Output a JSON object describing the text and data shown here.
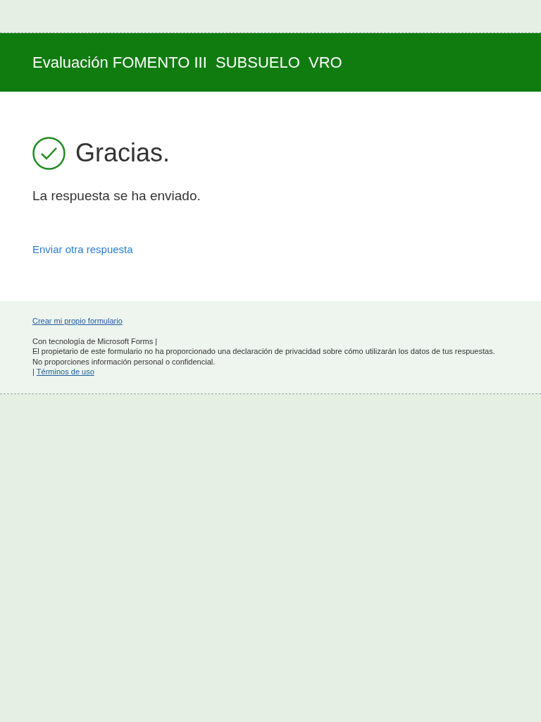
{
  "header": {
    "title": "Evaluación FOMENTO III  SUBSUELO  VRO"
  },
  "confirmation": {
    "heading": "Gracias.",
    "message": "La respuesta se ha enviado.",
    "link": "Enviar otra respuesta"
  },
  "footer": {
    "create_link": "Crear mi propio formulario",
    "powered_by": "Con tecnología de Microsoft Forms |",
    "privacy_notice": "El propietario de este formulario no ha proporcionado una declaración de privacidad sobre cómo utilizarán los datos de tus respuestas.",
    "warning": "No proporciones información personal o confidencial.",
    "separator": "|",
    "terms_link": "Términos de uso"
  }
}
